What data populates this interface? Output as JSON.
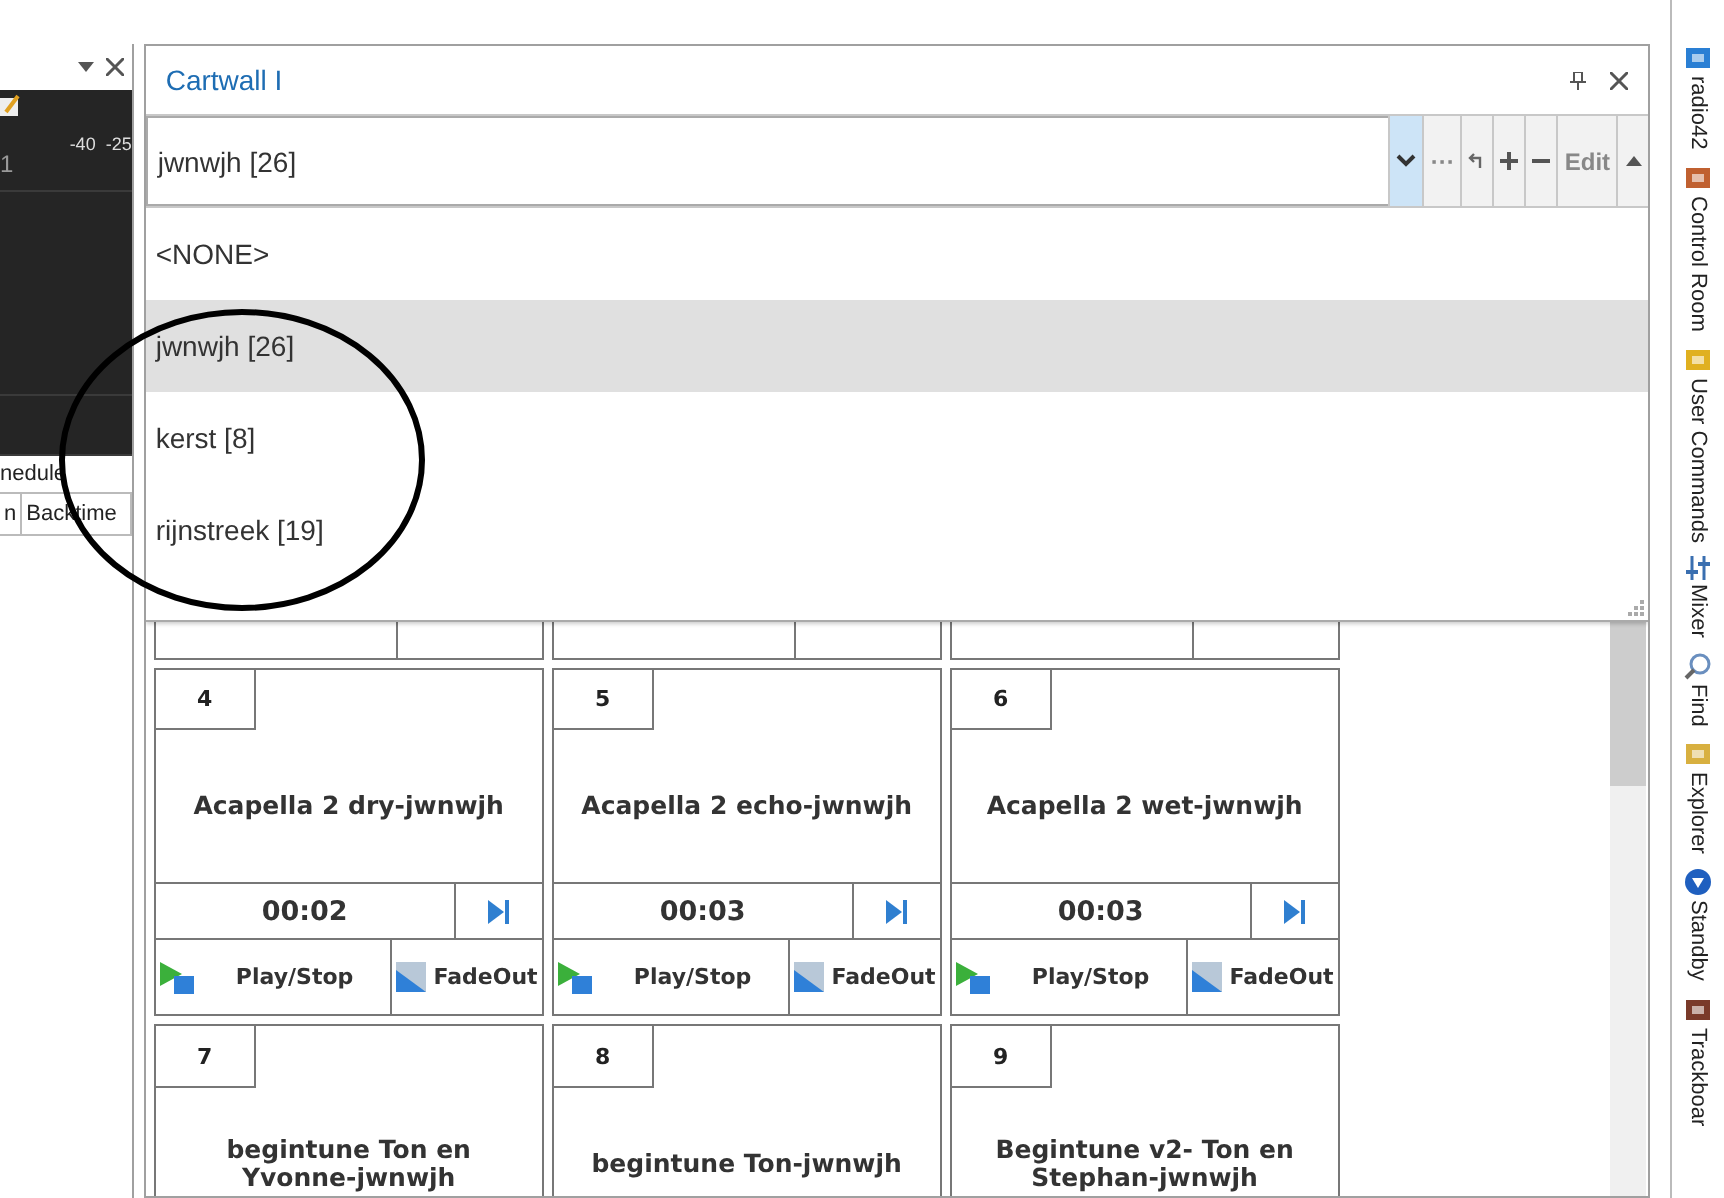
{
  "left_panel": {
    "meter_labels": [
      "-40",
      "-25"
    ],
    "counter": "1",
    "tab_label": "nedule",
    "columns": [
      "n",
      "Backtime"
    ]
  },
  "cartwall": {
    "title": "Cartwall I",
    "combo": {
      "value": "jwnwjh [26]",
      "buttons": [
        {
          "kind": "dropdown",
          "selected": true
        },
        {
          "kind": "more",
          "label": "···",
          "selected": false
        },
        {
          "kind": "undo",
          "selected": false
        },
        {
          "kind": "add",
          "selected": false
        },
        {
          "kind": "remove",
          "selected": false
        },
        {
          "kind": "edit",
          "label": "Edit",
          "selected": false
        },
        {
          "kind": "scroll-up",
          "selected": false
        }
      ]
    },
    "dropdown": {
      "items": [
        {
          "label": "<NONE>",
          "selected": false
        },
        {
          "label": "jwnwjh [26]",
          "selected": true
        },
        {
          "label": "kerst [8]",
          "selected": false
        },
        {
          "label": "rijnstreek [19]",
          "selected": false
        }
      ]
    },
    "carts": [
      {
        "kind": "covered"
      },
      {
        "kind": "covered"
      },
      {
        "kind": "covered"
      },
      {
        "kind": "full",
        "number": "4",
        "title": "Acapella 2 dry-jwnwjh",
        "time": "00:02",
        "play_label": "Play/Stop",
        "fade_label": "FadeOut"
      },
      {
        "kind": "full",
        "number": "5",
        "title": "Acapella 2 echo-jwnwjh",
        "time": "00:03",
        "play_label": "Play/Stop",
        "fade_label": "FadeOut"
      },
      {
        "kind": "full",
        "number": "6",
        "title": "Acapella 2 wet-jwnwjh",
        "time": "00:03",
        "play_label": "Play/Stop",
        "fade_label": "FadeOut"
      },
      {
        "kind": "full",
        "number": "7",
        "title": "begintune Ton en Yvonne-jwnwjh"
      },
      {
        "kind": "full",
        "number": "8",
        "title": "begintune Ton-jwnwjh"
      },
      {
        "kind": "full",
        "number": "9",
        "title": "Begintune v2- Ton en Stephan-jwnwjh"
      }
    ]
  },
  "sidebar_tabs": [
    {
      "kind": "radio",
      "label": "radio42"
    },
    {
      "kind": "control",
      "label": "Control Room"
    },
    {
      "kind": "commands",
      "label": "User Commands"
    },
    {
      "kind": "mixer",
      "label": "Mixer"
    },
    {
      "kind": "find",
      "label": "Find"
    },
    {
      "kind": "explorer",
      "label": "Explorer"
    },
    {
      "kind": "standby",
      "label": "Standby"
    },
    {
      "kind": "trackboard",
      "label": "Trackboar"
    }
  ]
}
